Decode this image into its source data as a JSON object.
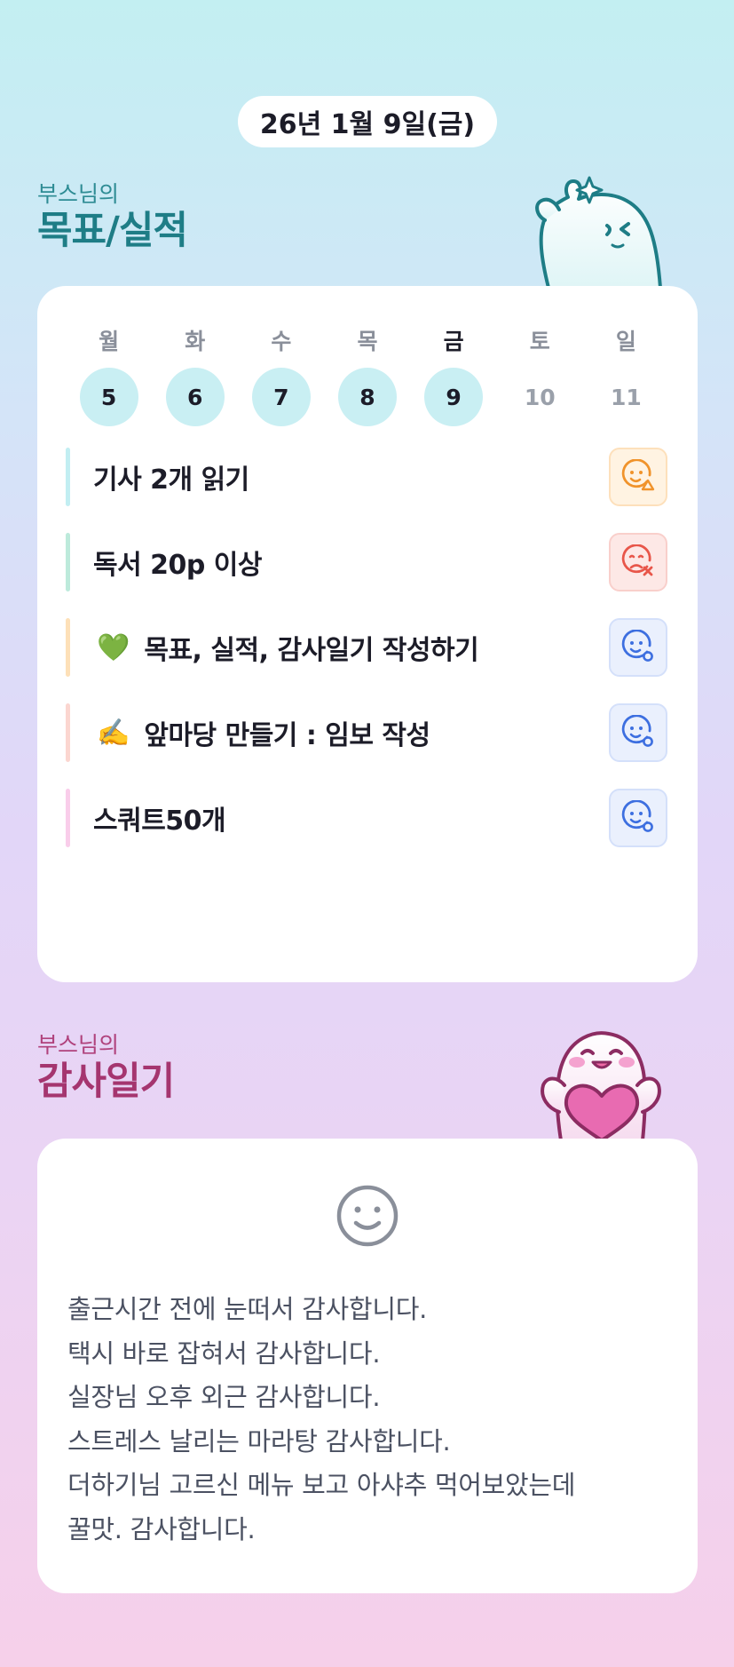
{
  "date": "26년 1월 9일(금)",
  "goals_section": {
    "subtitle": "부스님의",
    "title": "목표/실적"
  },
  "week": [
    {
      "name": "월",
      "num": "5",
      "done": true,
      "today": false
    },
    {
      "name": "화",
      "num": "6",
      "done": true,
      "today": false
    },
    {
      "name": "수",
      "num": "7",
      "done": true,
      "today": false
    },
    {
      "name": "목",
      "num": "8",
      "done": true,
      "today": false
    },
    {
      "name": "금",
      "num": "9",
      "done": true,
      "today": true
    },
    {
      "name": "토",
      "num": "10",
      "done": false,
      "today": false
    },
    {
      "name": "일",
      "num": "11",
      "done": false,
      "today": false
    }
  ],
  "goals": [
    {
      "label": "기사 2개 읽기",
      "emoji": "",
      "bar_color": "#c2eef2",
      "status": "partial",
      "status_icon": "smile-triangle-icon"
    },
    {
      "label": "독서 20p 이상",
      "emoji": "",
      "bar_color": "#bdeadb",
      "status": "fail",
      "status_icon": "frown-x-icon"
    },
    {
      "label": "목표, 실적, 감사일기 작성하기",
      "emoji": "💚",
      "bar_color": "#fde0b8",
      "status": "success",
      "status_icon": "smile-circle-icon"
    },
    {
      "label": "앞마당 만들기 : 임보 작성",
      "emoji": "✍️",
      "bar_color": "#fbd6d0",
      "status": "success",
      "status_icon": "smile-circle-icon"
    },
    {
      "label": "스쿼트50개",
      "emoji": "",
      "bar_color": "#f9cdea",
      "status": "success",
      "status_icon": "smile-circle-icon"
    }
  ],
  "diary_section": {
    "subtitle": "부스님의",
    "title": "감사일기"
  },
  "diary": {
    "icon": "smile-face-icon",
    "lines": [
      "출근시간 전에 눈떠서 감사합니다.",
      "택시 바로 잡혀서 감사합니다.",
      "실장님 오후 외근 감사합니다.",
      "스트레스 날리는 마라탕 감사합니다.",
      "더하기님 고르신 메뉴 보고 아샤추 먹어보았는데",
      "꿀맛. 감사합니다."
    ]
  },
  "colors": {
    "teal": "#1e7d86",
    "pink": "#a5356f",
    "done_day": "#c9eff3",
    "partial": "#f0932b",
    "fail": "#e8564a",
    "success": "#3d6fe0"
  }
}
